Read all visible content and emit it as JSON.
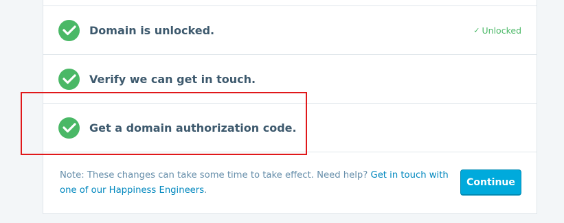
{
  "steps": [
    {
      "title": "Domain is unlocked.",
      "status": "Unlocked",
      "status_icon": "check-icon"
    },
    {
      "title": "Verify we can get in touch.",
      "status": ""
    },
    {
      "title": "Get a domain authorization code.",
      "status": ""
    }
  ],
  "footer": {
    "note": "Note: These changes can take some time to take effect. Need help? ",
    "link": "Get in touch with one of our Happiness Engineers",
    "end": "."
  },
  "continue_label": "Continue",
  "colors": {
    "success": "#4ab866",
    "title": "#3d596d",
    "note": "#668eaa",
    "link": "#0087be",
    "primary": "#00aadc",
    "highlight": "#e0181a"
  }
}
